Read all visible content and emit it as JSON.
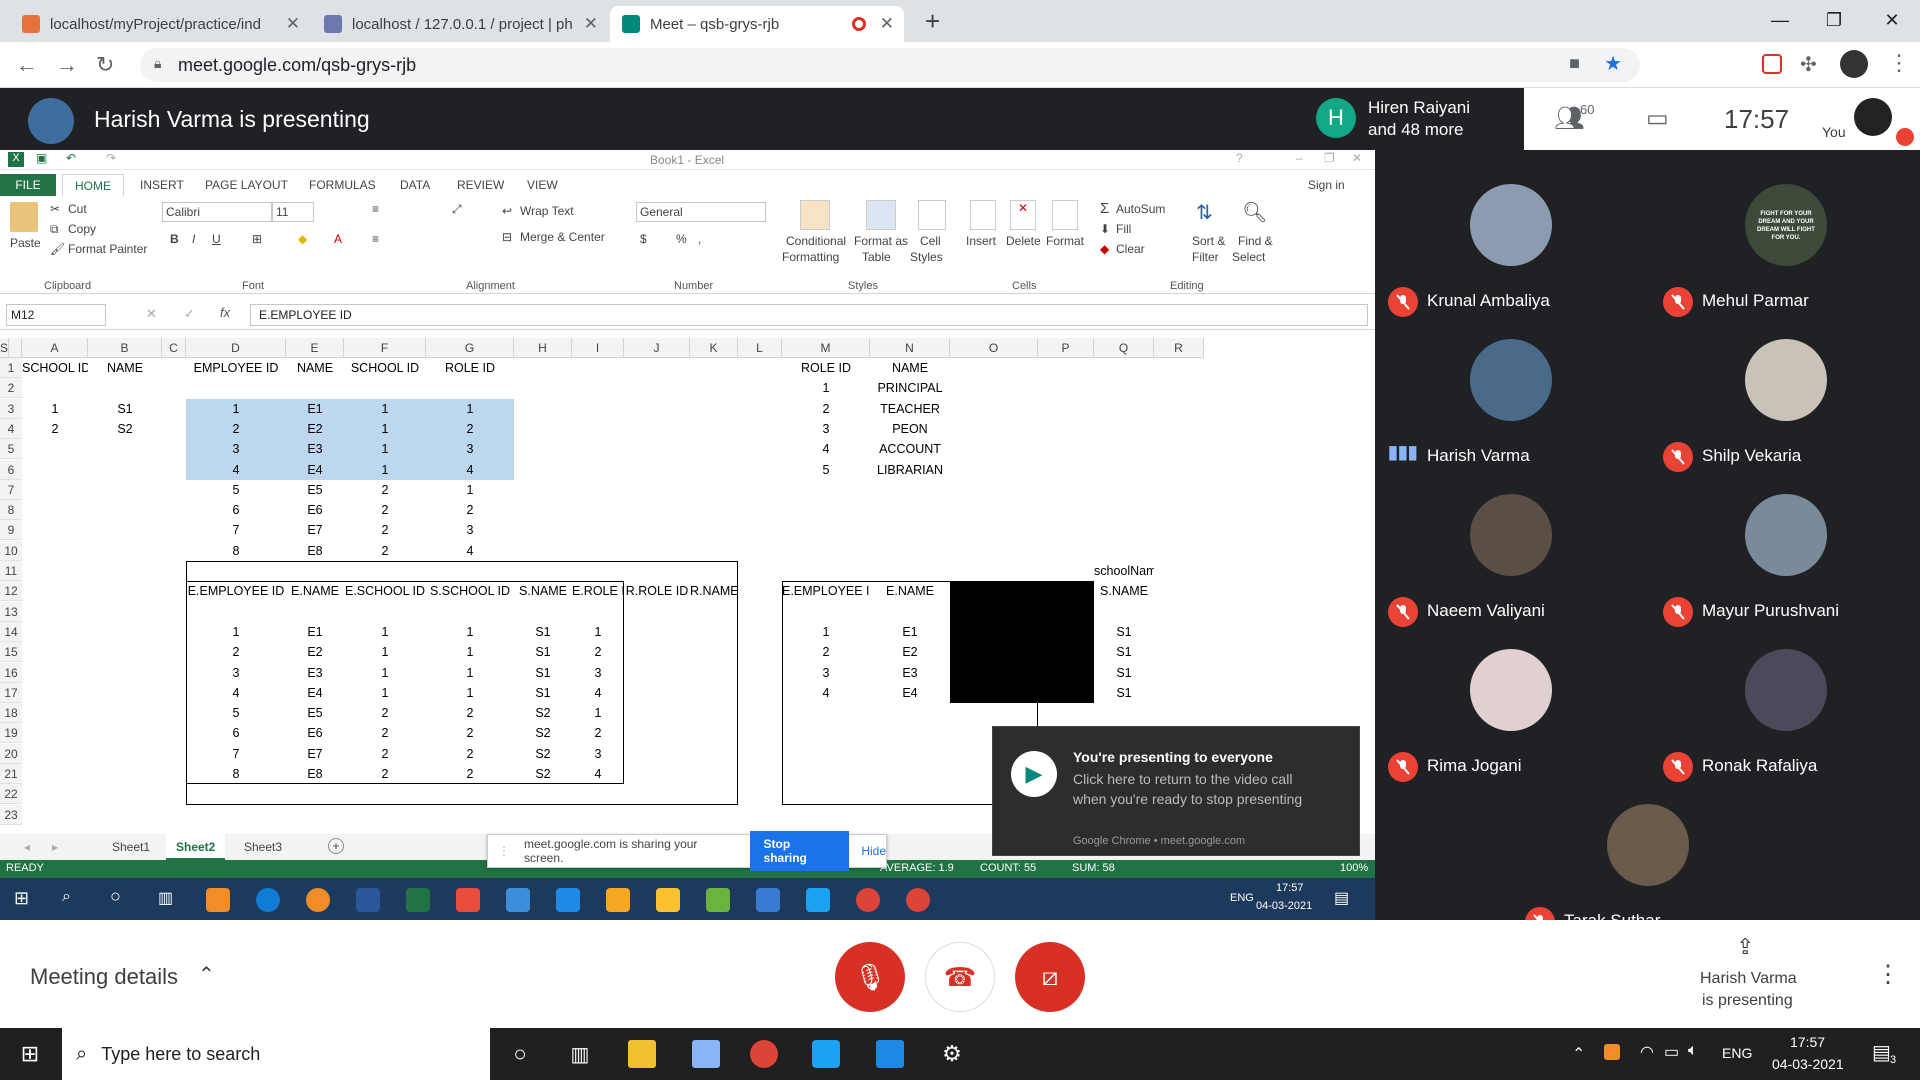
{
  "browser": {
    "tabs": [
      {
        "title": "localhost/myProject/practice/ind",
        "color": "#e8703a"
      },
      {
        "title": "localhost / 127.0.0.1 / project | ph",
        "color": "#6c78af"
      },
      {
        "title": "Meet – qsb-grys-rjb",
        "color": "#00897b"
      }
    ],
    "url": "meet.google.com/qsb-grys-rjb"
  },
  "meet": {
    "presenting_text": "Harish Varma is presenting",
    "others_initial": "H",
    "others_name": "Hiren Raiyani",
    "others_more": "and 48 more",
    "people_count": "60",
    "time": "17:57",
    "you_label": "You",
    "participants": [
      {
        "name": "Krunal Ambaliya",
        "speaking": false
      },
      {
        "name": "Mehul Parmar",
        "speaking": false
      },
      {
        "name": "Harish Varma",
        "speaking": true
      },
      {
        "name": "Shilp Vekaria",
        "speaking": false
      },
      {
        "name": "Naeem Valiyani",
        "speaking": false
      },
      {
        "name": "Mayur Purushvani",
        "speaking": false
      },
      {
        "name": "Rima Jogani",
        "speaking": false
      },
      {
        "name": "Ronak Rafaliya",
        "speaking": false
      },
      {
        "name": "Tarak Suthar",
        "speaking": false
      }
    ],
    "mehul_avatar_text": "FIGHT FOR YOUR DREAM AND YOUR DREAM WILL FIGHT FOR YOU.",
    "meeting_details": "Meeting details",
    "presenter_line1": "Harish Varma",
    "presenter_line2": "is presenting"
  },
  "excel": {
    "title": "Book1 - Excel",
    "sign_in": "Sign in",
    "tabs": [
      "FILE",
      "HOME",
      "INSERT",
      "PAGE LAYOUT",
      "FORMULAS",
      "DATA",
      "REVIEW",
      "VIEW"
    ],
    "ribbon": {
      "cut": "Cut",
      "copy": "Copy",
      "format_painter": "Format Painter",
      "paste": "Paste",
      "font": "Calibri",
      "size": "11",
      "wrap": "Wrap Text",
      "merge": "Merge & Center",
      "number_format": "General",
      "cond": "Conditional",
      "cond2": "Formatting",
      "fmt_table": "Format as",
      "fmt_table2": "Table",
      "cell_styles": "Cell",
      "cell_styles2": "Styles",
      "insert": "Insert",
      "delete": "Delete",
      "format": "Format",
      "autosum": "AutoSum",
      "fill": "Fill",
      "clear": "Clear",
      "sort": "Sort &",
      "sort2": "Filter",
      "find": "Find &",
      "find2": "Select",
      "groups": [
        "Clipboard",
        "Font",
        "Alignment",
        "Number",
        "Styles",
        "Cells",
        "Editing"
      ]
    },
    "name_box": "M12",
    "formula": "E.EMPLOYEE ID",
    "columns": [
      "A",
      "B",
      "C",
      "D",
      "E",
      "F",
      "G",
      "H",
      "I",
      "J",
      "K",
      "L",
      "M",
      "N",
      "O",
      "P",
      "Q",
      "R",
      "S"
    ],
    "rows": [
      "1",
      "2",
      "3",
      "4",
      "5",
      "6",
      "7",
      "8",
      "9",
      "10",
      "11",
      "12",
      "13",
      "14",
      "15",
      "16",
      "17",
      "18",
      "19",
      "20",
      "21",
      "22",
      "23"
    ],
    "headers_row1": {
      "A": "SCHOOL ID",
      "B": "NAME",
      "D": "EMPLOYEE ID",
      "E": "NAME",
      "F": "SCHOOL ID",
      "G": "ROLE ID",
      "M": "ROLE ID",
      "N": "NAME"
    },
    "school": [
      [
        "1",
        "S1"
      ],
      [
        "2",
        "S2"
      ]
    ],
    "employees": [
      [
        "1",
        "E1",
        "1",
        "1"
      ],
      [
        "2",
        "E2",
        "1",
        "2"
      ],
      [
        "3",
        "E3",
        "1",
        "3"
      ],
      [
        "4",
        "E4",
        "1",
        "4"
      ],
      [
        "5",
        "E5",
        "2",
        "1"
      ],
      [
        "6",
        "E6",
        "2",
        "2"
      ],
      [
        "7",
        "E7",
        "2",
        "3"
      ],
      [
        "8",
        "E8",
        "2",
        "4"
      ]
    ],
    "roles": [
      [
        "1",
        "PRINCIPAL"
      ],
      [
        "2",
        "TEACHER"
      ],
      [
        "3",
        "PEON"
      ],
      [
        "4",
        "ACCOUNT"
      ],
      [
        "5",
        "LIBRARIAN"
      ]
    ],
    "join_headers": [
      "E.EMPLOYEE ID",
      "E.NAME",
      "E.SCHOOL ID",
      "S.SCHOOL ID",
      "S.NAME",
      "E.ROLE ID",
      "R.ROLE ID",
      "R.NAME"
    ],
    "join_rows": [
      [
        "1",
        "E1",
        "1",
        "1",
        "S1",
        "1"
      ],
      [
        "2",
        "E2",
        "1",
        "1",
        "S1",
        "2"
      ],
      [
        "3",
        "E3",
        "1",
        "1",
        "S1",
        "3"
      ],
      [
        "4",
        "E4",
        "1",
        "1",
        "S1",
        "4"
      ],
      [
        "5",
        "E5",
        "2",
        "2",
        "S2",
        "1"
      ],
      [
        "6",
        "E6",
        "2",
        "2",
        "S2",
        "2"
      ],
      [
        "7",
        "E7",
        "2",
        "2",
        "S2",
        "3"
      ],
      [
        "8",
        "E8",
        "2",
        "2",
        "S2",
        "4"
      ]
    ],
    "right_headers": [
      "E.EMPLOYEE ID",
      "E.NAME",
      "S.NAME"
    ],
    "right_label": "schoolName",
    "right_rows": [
      [
        "1",
        "E1",
        "S1"
      ],
      [
        "2",
        "E2",
        "S1"
      ],
      [
        "3",
        "E3",
        "S1"
      ],
      [
        "4",
        "E4",
        "S1"
      ]
    ],
    "sheets": [
      "Sheet1",
      "Sheet2",
      "Sheet3"
    ],
    "status_ready": "READY",
    "status_avg": "AVERAGE: 1.9",
    "status_count": "COUNT: 55",
    "status_sum": "SUM: 58",
    "zoom": "100%",
    "inner_time": "17:57",
    "inner_date": "04-03-2021",
    "inner_lang": "ENG"
  },
  "share_bar": {
    "text": "meet.google.com is sharing your screen.",
    "stop": "Stop sharing",
    "hide": "Hide"
  },
  "toast": {
    "title": "You're presenting to everyone",
    "body": "Click here to return to the video call when you're ready to stop presenting",
    "footer": "Google Chrome • meet.google.com"
  },
  "taskbar": {
    "search_placeholder": "Type here to search",
    "lang": "ENG",
    "time": "17:57",
    "date": "04-03-2021",
    "notif_count": "3"
  }
}
